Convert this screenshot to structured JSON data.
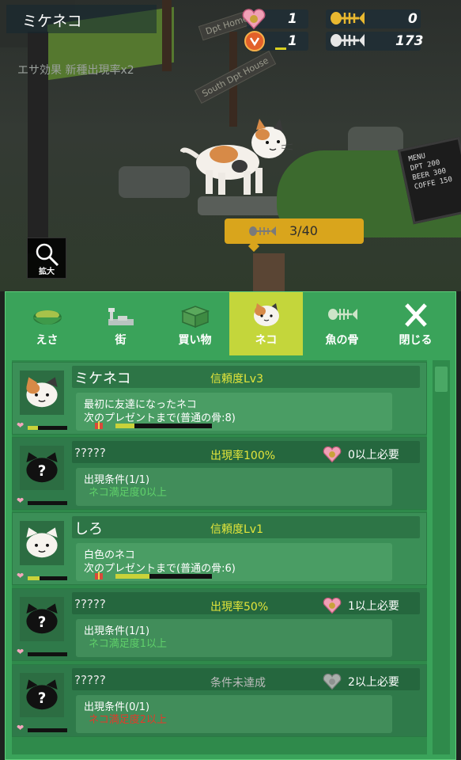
{
  "hud": {
    "cat_name": "ミケネコ",
    "feed_effect": "エサ効果 新種出現率x2",
    "counters": [
      {
        "icon": "heart-food-icon",
        "value": "1"
      },
      {
        "icon": "gold-fish-bone-icon",
        "value": "0"
      },
      {
        "icon": "level-badge-icon",
        "value": "1"
      },
      {
        "icon": "silver-fish-bone-icon",
        "value": "173"
      }
    ],
    "signs": [
      "Dpt Home",
      "South Dpt House"
    ],
    "menu_board": [
      "MENU",
      "DPT 200",
      "BEER 300",
      "COFFE 150"
    ],
    "progress": "3/40",
    "progress_fraction": 0.075,
    "zoom_label": "拡大"
  },
  "tabs": [
    {
      "label": "えさ",
      "icon": "food-bowl-icon",
      "active": false
    },
    {
      "label": "街",
      "icon": "town-icon",
      "active": false
    },
    {
      "label": "買い物",
      "icon": "shopping-box-icon",
      "active": false
    },
    {
      "label": "ネコ",
      "icon": "cat-face-icon",
      "active": true
    },
    {
      "label": "魚の骨",
      "icon": "fish-bone-icon",
      "active": false
    },
    {
      "label": "閉じる",
      "icon": "close-icon",
      "active": false
    }
  ],
  "cats": [
    {
      "type": "known",
      "name": "ミケネコ",
      "trust": "信頼度Lv3",
      "desc1": "最初に友達になったネコ",
      "desc2": "次のプレゼントまで(普通の骨:8)",
      "affection": 0.25,
      "gift_progress": 0.2,
      "portrait": "calico"
    },
    {
      "type": "unknown",
      "name": "?????",
      "rate": "出現率100%",
      "need": "0以上必要",
      "cond1": "出現条件(1/1)",
      "cond2": "ネコ満足度0以上",
      "cond_ok": true,
      "affection": 0,
      "rate_grey": false
    },
    {
      "type": "known",
      "name": "しろ",
      "trust": "信頼度Lv1",
      "desc1": "白色のネコ",
      "desc2": "次のプレゼントまで(普通の骨:6)",
      "affection": 0.3,
      "gift_progress": 0.35,
      "portrait": "white"
    },
    {
      "type": "unknown",
      "name": "?????",
      "rate": "出現率50%",
      "need": "1以上必要",
      "cond1": "出現条件(1/1)",
      "cond2": "ネコ満足度1以上",
      "cond_ok": true,
      "affection": 0,
      "rate_grey": false
    },
    {
      "type": "unknown",
      "name": "?????",
      "rate": "条件未達成",
      "need": "2以上必要",
      "cond1": "出現条件(0/1)",
      "cond2": "ネコ満足度2以上",
      "cond_ok": false,
      "affection": 0,
      "rate_grey": true
    }
  ],
  "colors": {
    "panel": "#3aa35a",
    "active_tab": "#c4d63b",
    "trust_text": "#e3e53b",
    "progress_pill": "#d9a51c"
  }
}
